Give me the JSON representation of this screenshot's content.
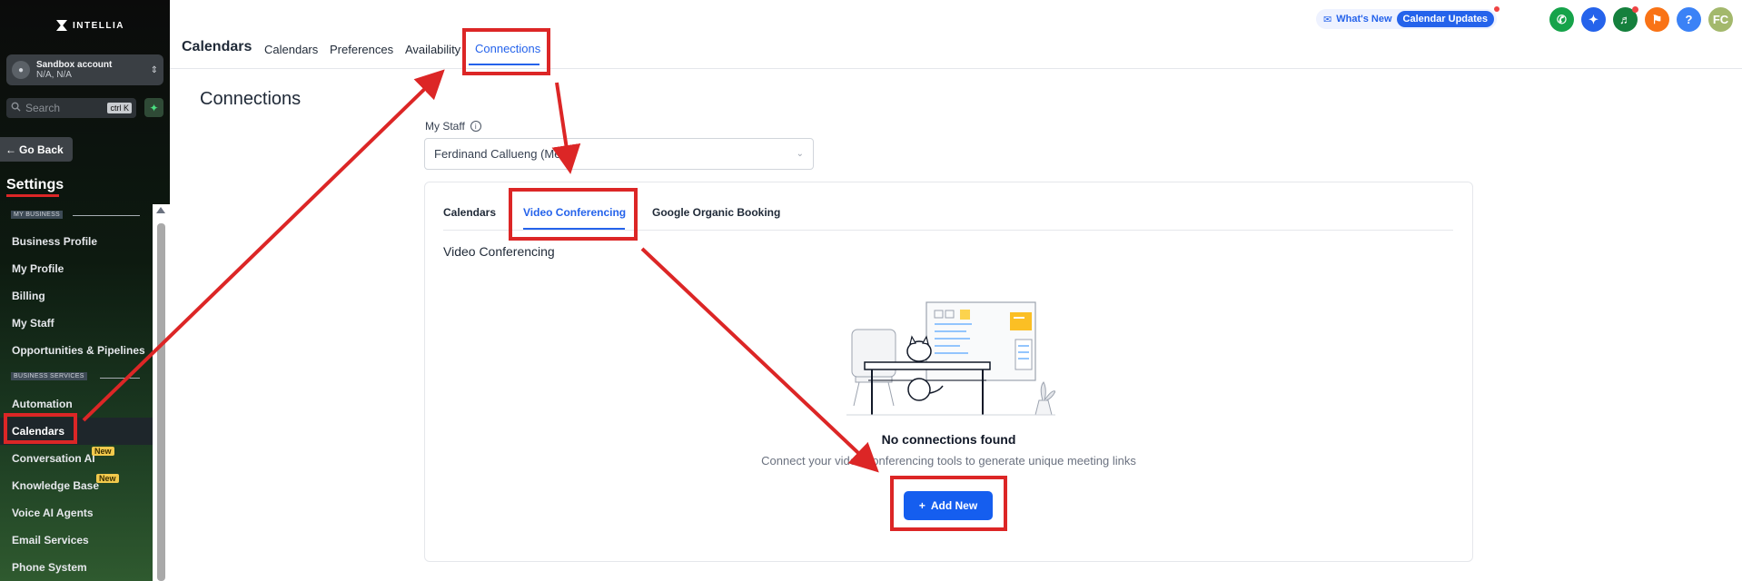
{
  "sidebar": {
    "logo_text": "INTELLIA",
    "account": {
      "name": "Sandbox account",
      "location": "N/A, N/A"
    },
    "search": {
      "placeholder": "Search",
      "shortcut": "ctrl K"
    },
    "go_back": "Go Back",
    "settings_title": "Settings",
    "sections": [
      {
        "label": "MY BUSINESS",
        "items": [
          "Business Profile",
          "My Profile",
          "Billing",
          "My Staff",
          "Opportunities & Pipelines"
        ]
      },
      {
        "label": "BUSINESS SERVICES",
        "items": [
          "Automation",
          "Calendars",
          "Conversation AI",
          "Knowledge Base",
          "Voice AI Agents",
          "Email Services",
          "Phone System"
        ]
      }
    ],
    "active_item": "Calendars",
    "new_badge": "New"
  },
  "header": {
    "title": "Calendars",
    "tabs": [
      "Calendars",
      "Preferences",
      "Availability",
      "Connections"
    ],
    "active_tab": "Connections",
    "whats_new": "What's New",
    "calendar_updates": "Calendar Updates",
    "user_initials": "FC",
    "help": "?"
  },
  "main": {
    "page_title": "Connections",
    "staff_label": "My Staff",
    "staff_value": "Ferdinand Callueng (Me)",
    "inner_tabs": [
      "Calendars",
      "Video Conferencing",
      "Google Organic Booking"
    ],
    "active_inner_tab": "Video Conferencing",
    "section_heading": "Video Conferencing",
    "empty_title": "No connections found",
    "empty_subtitle": "Connect your video conferencing tools to generate unique meeting links",
    "add_button": "Add New"
  },
  "colors": {
    "accent": "#2563eb",
    "annotation": "#dc2626",
    "phone": "#16a34a",
    "magic": "#2563eb",
    "megaphone": "#15803d",
    "bell": "#f97316",
    "help": "#3b82f6",
    "avatar": "#a3b86c"
  }
}
